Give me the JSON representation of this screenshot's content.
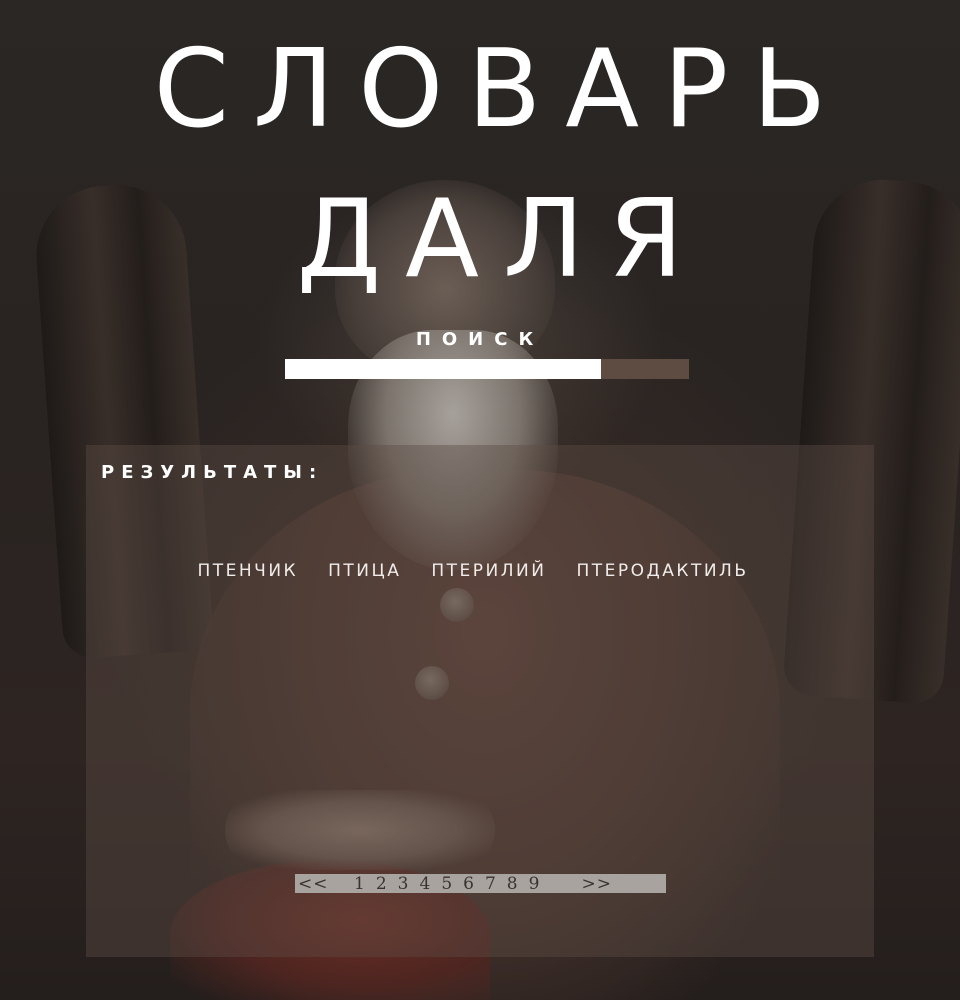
{
  "header": {
    "title_line1": "СЛОВАРЬ",
    "title_line2": "ДАЛЯ"
  },
  "search": {
    "label": "ПОИСК",
    "value": "",
    "button_label": ""
  },
  "results": {
    "title": "РЕЗУЛЬТАТЫ:",
    "words": [
      "ПТЕНЧИК",
      "ПТИЦА",
      "ПТЕРИЛИЙ",
      "ПТЕРОДАКТИЛЬ"
    ]
  },
  "pagination": {
    "prev": "<<",
    "pages": [
      "1",
      "2",
      "3",
      "4",
      "5",
      "6",
      "7",
      "8",
      "9"
    ],
    "next": ">>"
  },
  "colors": {
    "search_button": "#5e4c42",
    "pagination_bg": "#a8a39f"
  }
}
